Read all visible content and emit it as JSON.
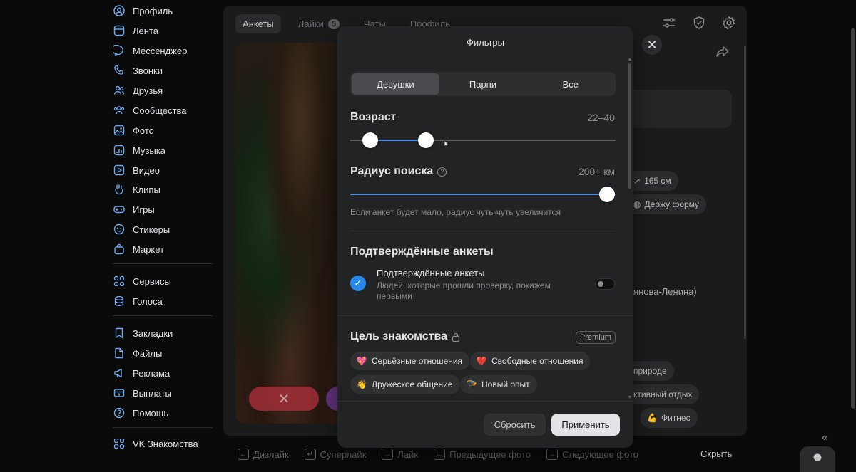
{
  "sidebar": {
    "items": [
      {
        "label": "Профиль",
        "icon": "user-circle-icon"
      },
      {
        "label": "Лента",
        "icon": "feed-icon"
      },
      {
        "label": "Мессенджер",
        "icon": "message-icon"
      },
      {
        "label": "Звонки",
        "icon": "phone-icon"
      },
      {
        "label": "Друзья",
        "icon": "friends-icon"
      },
      {
        "label": "Сообщества",
        "icon": "communities-icon"
      },
      {
        "label": "Фото",
        "icon": "photo-icon"
      },
      {
        "label": "Музыка",
        "icon": "music-icon"
      },
      {
        "label": "Видео",
        "icon": "video-icon"
      },
      {
        "label": "Клипы",
        "icon": "clips-icon"
      },
      {
        "label": "Игры",
        "icon": "games-icon"
      },
      {
        "label": "Стикеры",
        "icon": "sticker-icon"
      },
      {
        "label": "Маркет",
        "icon": "market-icon"
      },
      {
        "label": "Сервисы",
        "icon": "services-icon"
      },
      {
        "label": "Голоса",
        "icon": "coins-icon"
      },
      {
        "label": "Закладки",
        "icon": "bookmark-icon"
      },
      {
        "label": "Файлы",
        "icon": "file-icon"
      },
      {
        "label": "Реклама",
        "icon": "megaphone-icon"
      },
      {
        "label": "Выплаты",
        "icon": "payouts-icon"
      },
      {
        "label": "Помощь",
        "icon": "help-icon"
      },
      {
        "label": "VK Знакомства",
        "icon": "apps-icon"
      }
    ]
  },
  "tabs": [
    {
      "label": "Анкеты",
      "active": true
    },
    {
      "label": "Лайки",
      "count": "5"
    },
    {
      "label": "Чаты"
    },
    {
      "label": "Профиль"
    }
  ],
  "background": {
    "height_chip": "165 см",
    "fitness_chip": "Держу форму",
    "location_text": "янова-Ленина)",
    "nature_chip": "природе",
    "active_chip": "ктивный отдых",
    "fitness2_chip": "Фитнес"
  },
  "bottom_bar": {
    "hints": [
      {
        "key": "←",
        "label": "Дизлайк"
      },
      {
        "key": "↵",
        "label": "Суперлайк"
      },
      {
        "key": "→",
        "label": "Лайк"
      },
      {
        "key": "←",
        "label": "Предыдущее фото"
      },
      {
        "key": "→",
        "label": "Следующее фото"
      }
    ],
    "hide_label": "Скрыть"
  },
  "modal": {
    "title": "Фильтры",
    "gender_options": [
      "Девушки",
      "Парни",
      "Все"
    ],
    "gender_selected": "Девушки",
    "age": {
      "label": "Возраст",
      "value": "22–40",
      "min": 22,
      "max": 40
    },
    "radius": {
      "label": "Радиус поиска",
      "value": "200+ км",
      "fraction": 1.0,
      "note": "Если анкет будет мало, радиус чуть-чуть увеличится"
    },
    "verified": {
      "section_title": "Подтверждённые анкеты",
      "label": "Подтверждённые анкеты",
      "description": "Людей, которые прошли проверку, покажем первыми",
      "enabled": false
    },
    "goal": {
      "section_title": "Цель знакомства",
      "badge": "Premium",
      "chips": [
        {
          "label": "Серьёзные отношения",
          "emoji": "💖"
        },
        {
          "label": "Свободные отношения",
          "emoji": "💔"
        },
        {
          "label": "Дружеское общение",
          "emoji": "👋"
        },
        {
          "label": "Новый опыт",
          "emoji": "🪂"
        }
      ]
    },
    "reset_label": "Сбросить",
    "apply_label": "Применить"
  },
  "colors": {
    "accent": "#4d8fe8",
    "check": "#2688eb",
    "modal_bg": "#222324"
  }
}
